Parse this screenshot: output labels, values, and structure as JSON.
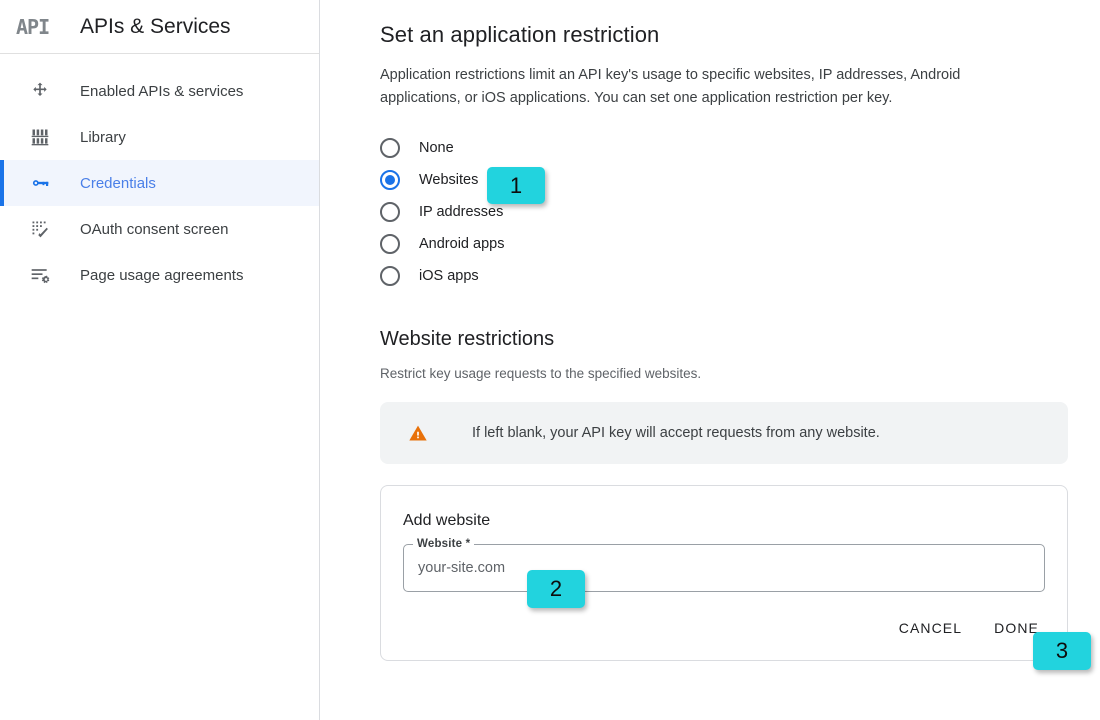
{
  "sidebar": {
    "logo_text": "API",
    "app_title": "APIs & Services",
    "items": [
      {
        "label": "Enabled APIs & services",
        "icon": "dashboard-icon",
        "active": false
      },
      {
        "label": "Library",
        "icon": "library-icon",
        "active": false
      },
      {
        "label": "Credentials",
        "icon": "key-icon",
        "active": true
      },
      {
        "label": "OAuth consent screen",
        "icon": "oauth-consent-icon",
        "active": false
      },
      {
        "label": "Page usage agreements",
        "icon": "page-usage-icon",
        "active": false
      }
    ]
  },
  "main": {
    "heading": "Set an application restriction",
    "description": "Application restrictions limit an API key's usage to specific websites, IP addresses, Android applications, or iOS applications. You can set one application restriction per key.",
    "restriction_options": [
      {
        "label": "None",
        "selected": false
      },
      {
        "label": "Websites",
        "selected": true
      },
      {
        "label": "IP addresses",
        "selected": false
      },
      {
        "label": "Android apps",
        "selected": false
      },
      {
        "label": "iOS apps",
        "selected": false
      }
    ],
    "website_restrictions": {
      "heading": "Website restrictions",
      "subtext": "Restrict key usage requests to the specified websites.",
      "alert": {
        "icon": "warning-triangle-icon",
        "text": "If left blank, your API key will accept requests from any website."
      },
      "add_website_card": {
        "title": "Add website",
        "field_label": "Website *",
        "field_value": "your-site.com",
        "field_placeholder": "",
        "cancel_label": "CANCEL",
        "done_label": "DONE"
      }
    }
  },
  "badges": [
    {
      "number": "1"
    },
    {
      "number": "2"
    },
    {
      "number": "3"
    }
  ],
  "colors": {
    "accent_blue": "#1a73e8",
    "badge_cyan": "#22d3de",
    "warning_orange": "#e8710a",
    "alert_bg": "#f1f3f4",
    "active_nav_bg": "#f1f5fd"
  }
}
